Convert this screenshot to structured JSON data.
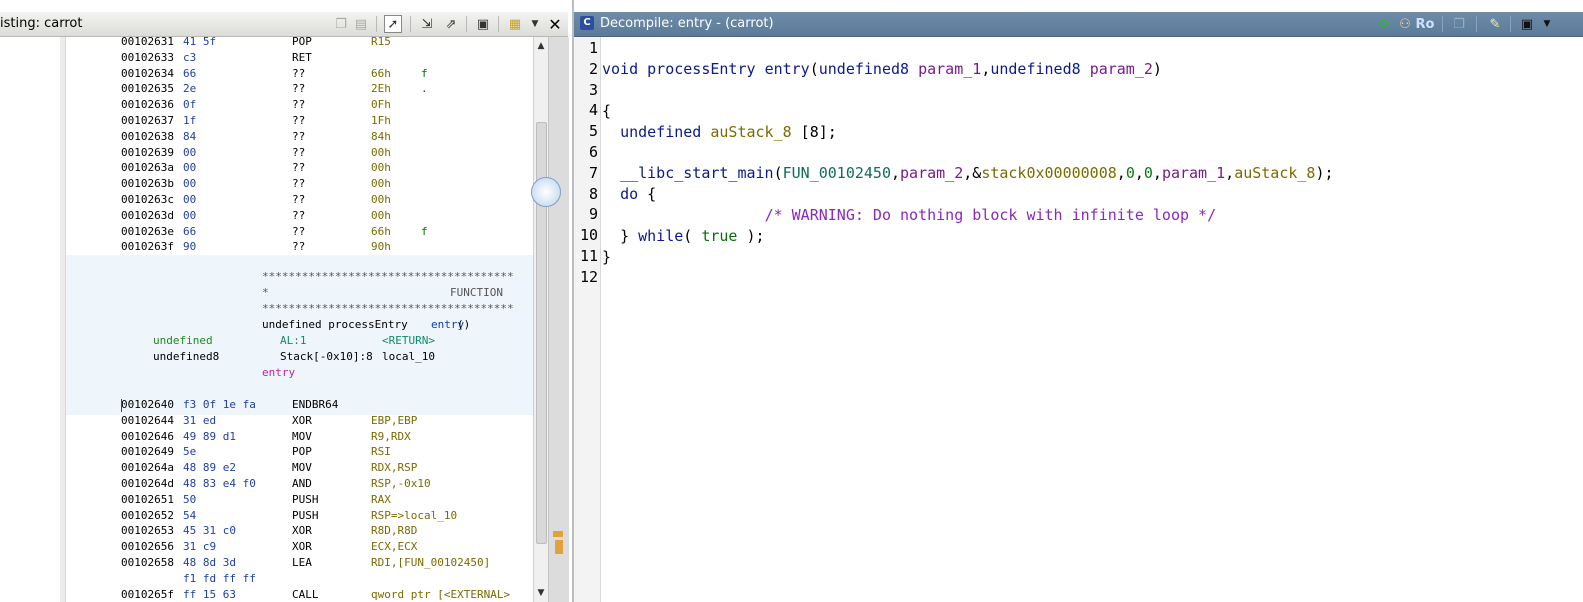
{
  "listing": {
    "title": "isting:  carrot",
    "rows_top": [
      {
        "addr": "00102631",
        "bytes": "41 5f",
        "mnem": "POP",
        "oper": "R15",
        "ch": ""
      },
      {
        "addr": "00102633",
        "bytes": "c3",
        "mnem": "RET",
        "oper": "",
        "ch": ""
      },
      {
        "addr": "00102634",
        "bytes": "66",
        "mnem": "??",
        "oper": "66h",
        "ch": "f"
      },
      {
        "addr": "00102635",
        "bytes": "2e",
        "mnem": "??",
        "oper": "2Eh",
        "ch": "."
      },
      {
        "addr": "00102636",
        "bytes": "0f",
        "mnem": "??",
        "oper": "0Fh",
        "ch": ""
      },
      {
        "addr": "00102637",
        "bytes": "1f",
        "mnem": "??",
        "oper": "1Fh",
        "ch": ""
      },
      {
        "addr": "00102638",
        "bytes": "84",
        "mnem": "??",
        "oper": "84h",
        "ch": ""
      },
      {
        "addr": "00102639",
        "bytes": "00",
        "mnem": "??",
        "oper": "00h",
        "ch": ""
      },
      {
        "addr": "0010263a",
        "bytes": "00",
        "mnem": "??",
        "oper": "00h",
        "ch": ""
      },
      {
        "addr": "0010263b",
        "bytes": "00",
        "mnem": "??",
        "oper": "00h",
        "ch": ""
      },
      {
        "addr": "0010263c",
        "bytes": "00",
        "mnem": "??",
        "oper": "00h",
        "ch": ""
      },
      {
        "addr": "0010263d",
        "bytes": "00",
        "mnem": "??",
        "oper": "00h",
        "ch": ""
      },
      {
        "addr": "0010263e",
        "bytes": "66",
        "mnem": "??",
        "oper": "66h",
        "ch": "f"
      },
      {
        "addr": "0010263f",
        "bytes": "90",
        "mnem": "??",
        "oper": "90h",
        "ch": ""
      }
    ],
    "function_header": {
      "stars": "**************************************",
      "star_line": "*",
      "label": "FUNCTION",
      "signature_prefix": "undefined processEntry ",
      "signature_name": "entry",
      "signature_suffix": "()",
      "ret_type": "undefined",
      "ret_loc": "AL:1",
      "ret_name": "<RETURN>",
      "var_type": "undefined8",
      "var_loc": "Stack[-0x10]:8",
      "var_name": "local_10",
      "entry_label": "entry"
    },
    "rows_bottom": [
      {
        "addr": "00102640",
        "bytes": "f3 0f 1e fa",
        "mnem": "ENDBR64",
        "oper": "",
        "oper2": ""
      },
      {
        "addr": "00102644",
        "bytes": "31 ed",
        "mnem": "XOR",
        "oper": "EBP,EBP",
        "oper2": ""
      },
      {
        "addr": "00102646",
        "bytes": "49 89 d1",
        "mnem": "MOV",
        "oper": "R9,RDX",
        "oper2": ""
      },
      {
        "addr": "00102649",
        "bytes": "5e",
        "mnem": "POP",
        "oper": "RSI",
        "oper2": ""
      },
      {
        "addr": "0010264a",
        "bytes": "48 89 e2",
        "mnem": "MOV",
        "oper": "RDX,RSP",
        "oper2": ""
      },
      {
        "addr": "0010264d",
        "bytes": "48 83 e4 f0",
        "mnem": "AND",
        "oper": "RSP,-0x10",
        "oper2": ""
      },
      {
        "addr": "00102651",
        "bytes": "50",
        "mnem": "PUSH",
        "oper": "RAX",
        "oper2": ""
      },
      {
        "addr": "00102652",
        "bytes": "54",
        "mnem": "PUSH",
        "oper": "RSP=>local_10",
        "oper2": ""
      },
      {
        "addr": "00102653",
        "bytes": "45 31 c0",
        "mnem": "XOR",
        "oper": "R8D,R8D",
        "oper2": ""
      },
      {
        "addr": "00102656",
        "bytes": "31 c9",
        "mnem": "XOR",
        "oper": "ECX,ECX",
        "oper2": ""
      },
      {
        "addr": "00102658",
        "bytes": "48 8d 3d",
        "mnem": "LEA",
        "oper": "RDI,[FUN_00102450]",
        "oper2": ""
      },
      {
        "addr": "",
        "bytes": "f1 fd ff ff",
        "mnem": "",
        "oper": "",
        "oper2": ""
      },
      {
        "addr": "0010265f",
        "bytes": "ff 15 63",
        "mnem": "CALL",
        "oper": "qword ptr [<EXTERNAL>",
        "oper2": ""
      }
    ]
  },
  "decompile": {
    "title": "Decompile: entry -  (carrot)",
    "ro_label": "Ro",
    "line_numbers": [
      "1",
      "2",
      "3",
      "4",
      "5",
      "6",
      "7",
      "8",
      "9",
      "10",
      "11",
      "12"
    ],
    "lines": {
      "l2": {
        "kw": "void",
        "type": "processEntry",
        "name": "entry",
        "open": "(",
        "t1": "undefined8",
        "p1": "param_1",
        "comma": ",",
        "t2": "undefined8",
        "p2": "param_2",
        "close": ")"
      },
      "l4": "{",
      "l5": {
        "indent": "  ",
        "type": "undefined",
        "var": "auStack_8",
        "rest": " [8];"
      },
      "l7": {
        "indent": "  ",
        "fn": "__libc_start_main",
        "open": "(",
        "a1": "FUN_00102450",
        "c1": ",",
        "a2": "param_2",
        "c2": ",&",
        "a3": "stack0x00000008",
        "c3": ",",
        "a4": "0",
        "c4": ",",
        "a5": "0",
        "c5": ",",
        "a6": "param_1",
        "c6": ",",
        "a7": "auStack_8",
        "close": ");"
      },
      "l8": {
        "indent": "  ",
        "kw": "do",
        "rest": " {"
      },
      "l9": {
        "indent": "                  ",
        "comment": "/* WARNING: Do nothing block with infinite loop */"
      },
      "l10": {
        "indent": "  ",
        "pre": "} ",
        "kw": "while",
        "open": "( ",
        "lit": "true",
        "close": " );"
      },
      "l11": "}"
    }
  },
  "icons": {
    "listing_toolbar": [
      "copy-icon",
      "paste-icon",
      "cursor-icon",
      "navigate-icon",
      "field-icon",
      "snapshot-icon",
      "layout-icon",
      "dropdown-icon",
      "close-icon"
    ],
    "decompile_toolbar": [
      "refresh-icon",
      "graph-icon",
      "copy-icon",
      "edit-icon",
      "snapshot-icon",
      "dropdown-icon"
    ]
  }
}
